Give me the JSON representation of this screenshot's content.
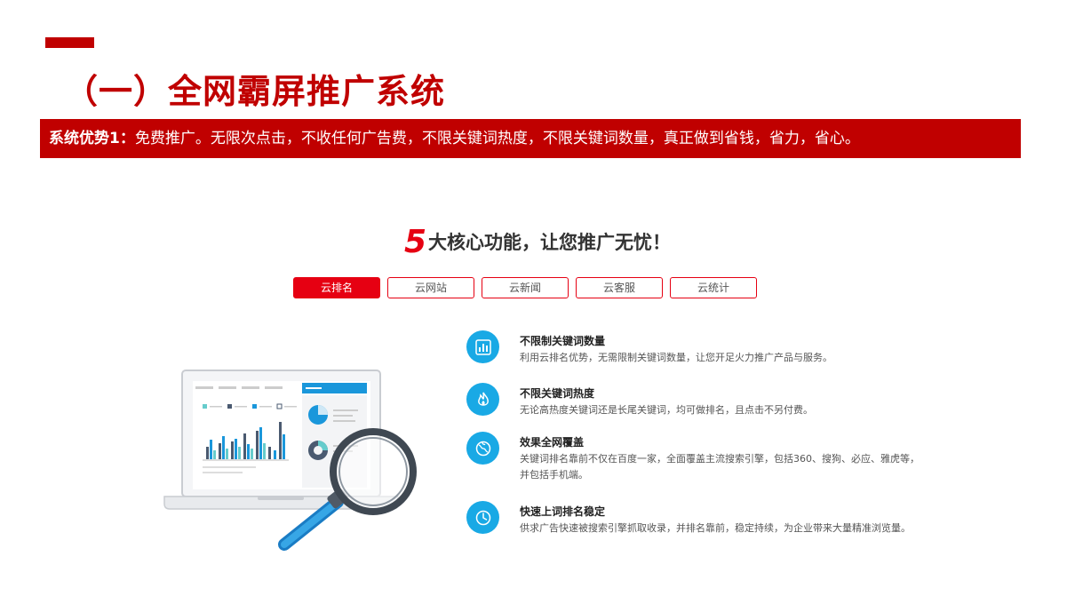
{
  "header": {
    "title": "（一）全网霸屏推广系统",
    "banner_label": "系统优势1：",
    "banner_text": "免费推广。无限次点击，不收任何广告费，不限关键词热度，不限关键词数量，真正做到省钱，省力，省心。"
  },
  "main": {
    "headline_number": "5",
    "headline_text": "大核心功能，让您推广无忧！",
    "tabs": [
      {
        "label": "云排名",
        "active": true
      },
      {
        "label": "云网站",
        "active": false
      },
      {
        "label": "云新闻",
        "active": false
      },
      {
        "label": "云客服",
        "active": false
      },
      {
        "label": "云统计",
        "active": false
      }
    ],
    "features": [
      {
        "icon": "bar-chart-icon",
        "title": "不限制关键词数量",
        "desc": "利用云排名优势，无需限制关键词数量，让您开足火力推广产品与服务。"
      },
      {
        "icon": "flame-icon",
        "title": "不限关键词热度",
        "desc": "无论高热度关键词还是长尾关键词，均可做排名，且点击不另付费。"
      },
      {
        "icon": "globe-icon",
        "title": "效果全网覆盖",
        "desc": "关键词排名靠前不仅在百度一家，全面覆盖主流搜索引擎，包括360、搜狗、必应、雅虎等，并包括手机端。"
      },
      {
        "icon": "clock-icon",
        "title": "快速上词排名稳定",
        "desc": "供求广告快速被搜索引擎抓取收录，并排名靠前，稳定持续，为企业带来大量精准浏览量。"
      }
    ]
  },
  "colors": {
    "brand_red": "#c00000",
    "tab_red": "#e60012",
    "icon_blue": "#19a9e5"
  }
}
